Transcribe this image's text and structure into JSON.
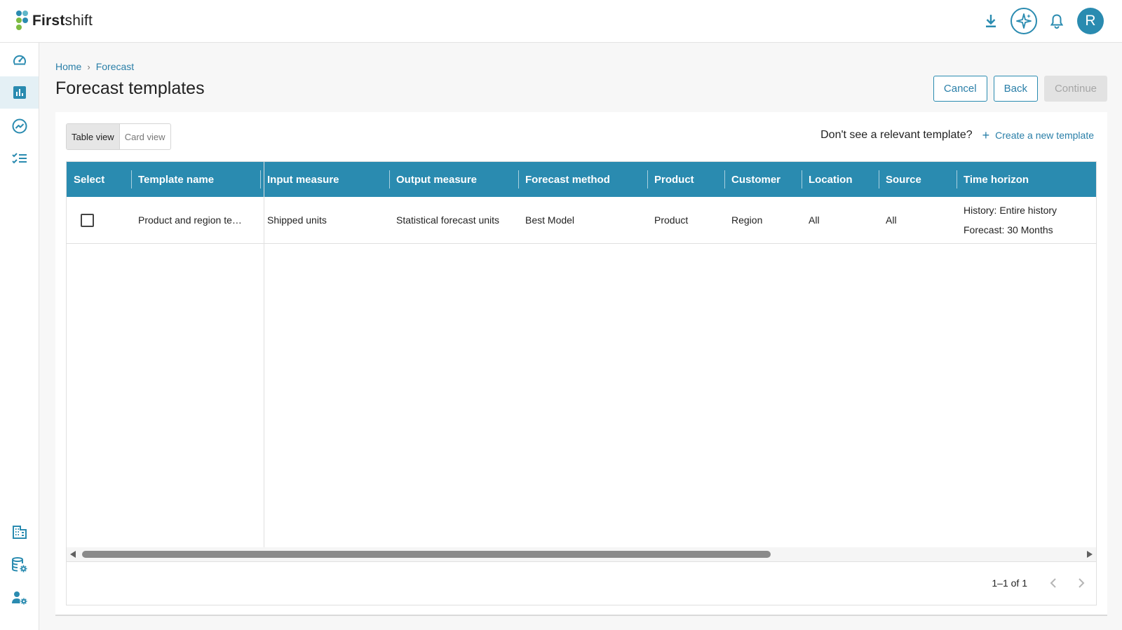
{
  "header": {
    "brand_bold": "First",
    "brand_rest": "shift",
    "avatar_initial": "R",
    "icons": [
      "download-icon",
      "ai-sparkle-icon",
      "bell-icon"
    ]
  },
  "sidebar": {
    "items": [
      {
        "name": "dashboard",
        "icon": "speedometer-icon"
      },
      {
        "name": "forecast",
        "icon": "bar-chart-icon",
        "active": true
      },
      {
        "name": "analytics",
        "icon": "trend-icon"
      },
      {
        "name": "tasks",
        "icon": "checklist-icon"
      },
      {
        "name": "organization",
        "icon": "building-icon"
      },
      {
        "name": "data-settings",
        "icon": "database-gear-icon"
      },
      {
        "name": "user-settings",
        "icon": "user-gear-icon"
      }
    ]
  },
  "breadcrumb": {
    "home": "Home",
    "separator": "›",
    "current": "Forecast"
  },
  "page": {
    "title": "Forecast templates"
  },
  "actions": {
    "cancel": "Cancel",
    "back": "Back",
    "continue": "Continue"
  },
  "view_toggle": {
    "table": "Table view",
    "card": "Card view",
    "selected": "Table view"
  },
  "prompt": {
    "question": "Don't see a relevant template?",
    "plus": "+",
    "create": "Create a new template"
  },
  "table": {
    "columns": [
      "Select",
      "Template name",
      "Input measure",
      "Output measure",
      "Forecast method",
      "Product",
      "Customer",
      "Location",
      "Source",
      "Time horizon"
    ],
    "rows": [
      {
        "selected": false,
        "template_name": "Product and region te…",
        "input_measure": "Shipped units",
        "output_measure": "Statistical forecast units",
        "forecast_method": "Best Model",
        "product": "Product",
        "customer": "Region",
        "location": "All",
        "source": "All",
        "time_horizon_history": "History: Entire history",
        "time_horizon_forecast": "Forecast: 30 Months"
      }
    ]
  },
  "pagination": {
    "range": "1–1 of 1"
  },
  "colors": {
    "accent": "#2a8bb0",
    "link": "#2a7fa8",
    "logo_dots": [
      "#2a8bb0",
      "#5fb7c9",
      "#7dbb42",
      "#2a8bb0",
      "#7dbb42"
    ]
  }
}
